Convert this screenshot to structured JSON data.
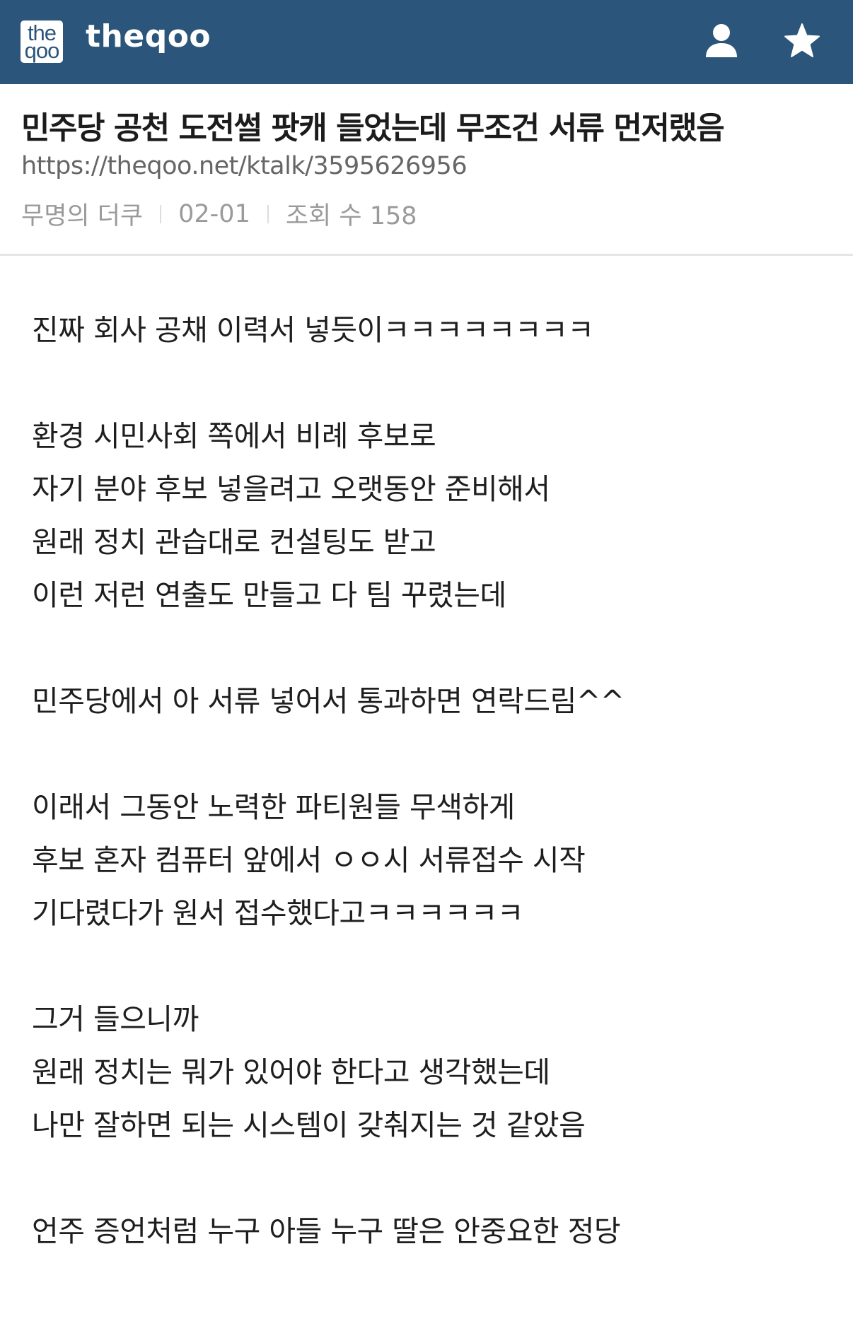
{
  "header": {
    "logo_line1": "the",
    "logo_line2": "qoo",
    "site_name": "theqoo"
  },
  "icons": {
    "user": "user-icon",
    "star": "star-icon"
  },
  "post": {
    "title": "민주당 공천 도전썰 팟캐 들었는데 무조건 서류 먼저랬음",
    "url": "https://theqoo.net/ktalk/3595626956",
    "author": "무명의 더쿠",
    "date": "02-01",
    "views": "조회 수 158"
  },
  "body": {
    "paragraphs": [
      [
        "진짜 회사 공채 이력서 넣듯이ㅋㅋㅋㅋㅋㅋㅋㅋ"
      ],
      [
        "환경 시민사회 쪽에서 비례 후보로",
        "자기 분야 후보 넣을려고 오랫동안 준비해서",
        "원래 정치 관습대로 컨설팅도 받고",
        "이런 저런 연출도 만들고 다 팀 꾸렸는데"
      ],
      [
        "민주당에서 아 서류 넣어서 통과하면 연락드림^^"
      ],
      [
        "이래서 그동안 노력한 파티원들 무색하게",
        "후보 혼자 컴퓨터 앞에서 ㅇㅇ시 서류접수 시작",
        "기다렸다가 원서 접수했다고ㅋㅋㅋㅋㅋㅋ"
      ],
      [
        "그거 들으니까",
        "원래 정치는 뭐가 있어야 한다고 생각했는데",
        "나만 잘하면 되는 시스템이 갖춰지는 것 같았음"
      ],
      [
        "언주 증언처럼 누구 아들 누구 딸은 안중요한 정당"
      ]
    ]
  },
  "colors": {
    "topbar": "#2b557a",
    "divider": "#e6e6e6"
  }
}
